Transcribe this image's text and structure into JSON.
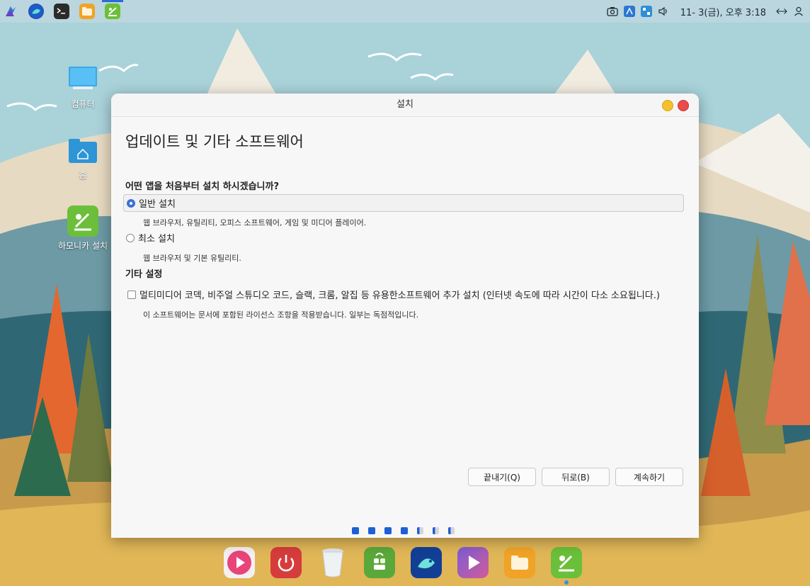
{
  "top_panel": {
    "apps": [
      {
        "icon": "launcher-icon"
      },
      {
        "icon": "browser-icon"
      },
      {
        "icon": "terminal-icon"
      },
      {
        "icon": "files-icon"
      },
      {
        "icon": "installer-icon"
      }
    ],
    "clock": "11- 3(금), 오후 3:18"
  },
  "desktop": {
    "icons": [
      {
        "label": "컴퓨터",
        "icon": "computer-icon"
      },
      {
        "label": "홈",
        "icon": "home-folder-icon"
      },
      {
        "label": "하모니카 설치",
        "icon": "installer-icon"
      }
    ]
  },
  "window": {
    "title": "설치",
    "heading": "업데이트 및 기타 소프트웨어",
    "question": "어떤 앱을 처음부터 설치 하시겠습니까?",
    "options": [
      {
        "label": "일반 설치",
        "description": "웹 브라우저, 유틸리티, 오피스  소프트웨어, 게임 및 미디어 플레이어.",
        "selected": true
      },
      {
        "label": "최소 설치",
        "description": "웹 브라우저 및 기본 유틸리티.",
        "selected": false
      }
    ],
    "other_section": "기타 설정",
    "third_party": {
      "label": "멀티미디어 코덱, 비주얼 스튜디오 코드, 슬랙, 크롬, 알집 등 유용한소프트웨어 추가 설치 (인터넷 속도에 따라 시간이 다소 소요됩니다.)",
      "description": "이 소프트웨어는 문서에 포함된 라이선스 조항을 적용받습니다. 일부는 독점적입니다.",
      "checked": false
    },
    "buttons": {
      "quit": "끝내기(Q)",
      "back": "뒤로(B)",
      "continue": "계속하기"
    },
    "progress": {
      "completed_steps": 4,
      "total_steps": 7
    }
  },
  "dock": {
    "apps": [
      {
        "icon": "media-icon"
      },
      {
        "icon": "power-icon"
      },
      {
        "icon": "trash-icon"
      },
      {
        "icon": "app-store-icon"
      },
      {
        "icon": "browser-icon"
      },
      {
        "icon": "video-player-icon"
      },
      {
        "icon": "files-icon"
      },
      {
        "icon": "installer-icon"
      }
    ]
  },
  "colors": {
    "accent": "#1f5fd6",
    "close": "#ec4b4b",
    "minimize": "#f5c02a"
  }
}
